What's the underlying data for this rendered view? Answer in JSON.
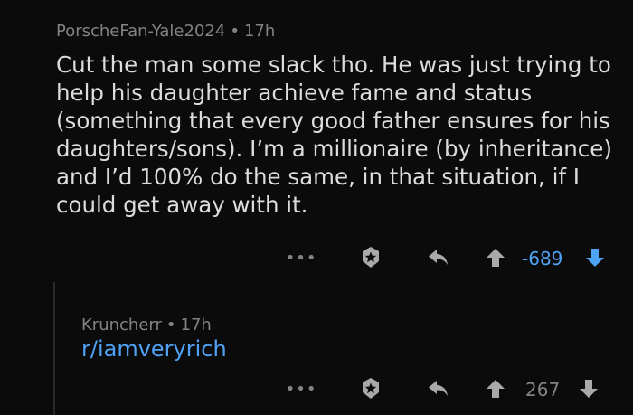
{
  "comments": [
    {
      "author": "PorscheFan-Yale2024",
      "separator": "•",
      "time": "17h",
      "body": "Cut the man some slack tho. He was just trying to help his daughter achieve fame and status (something that every good father ensures for his daughters/sons). I’m a millionaire (by inheritance) and I’d 100% do the same, in that situation, if I could get away with it.",
      "more": "•••",
      "score": "-689",
      "vote_state": "downvoted"
    },
    {
      "author": "Kruncherr",
      "separator": "•",
      "time": "17h",
      "link": "r/iamveryrich",
      "more": "•••",
      "score": "267",
      "vote_state": "none"
    }
  ],
  "colors": {
    "background": "#0b0b0b",
    "meta_text": "#818384",
    "body_text": "#dcdcdc",
    "link": "#4fa3f7",
    "downvote_active": "#4fa3f7",
    "icon_gray": "#9a9a9a"
  },
  "icons": {
    "more": "more-options-icon",
    "award": "award-icon",
    "reply": "reply-icon",
    "upvote": "upvote-arrow-icon",
    "downvote": "downvote-arrow-icon"
  }
}
